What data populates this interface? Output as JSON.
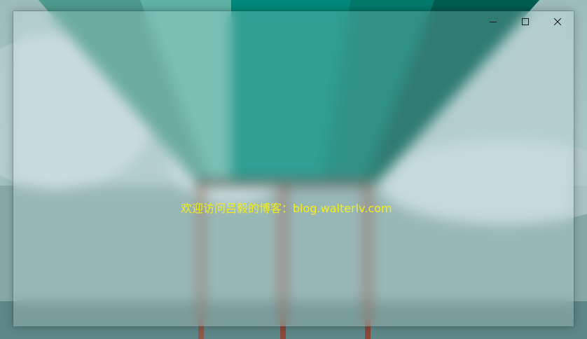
{
  "window": {
    "caption": {
      "minimize_icon": "minimize-icon",
      "maximize_icon": "maximize-icon",
      "close_icon": "close-icon"
    },
    "message": "欢迎访问吕毅的博客：blog.walterlv.com",
    "message_color": "#f5ee1c"
  },
  "background": {
    "sky_color": "#a9c6c6",
    "balloon_colors": [
      "#00897b",
      "#006b5e",
      "#4db6a6",
      "#00574b"
    ],
    "rope_color": "#8a4a3a"
  }
}
